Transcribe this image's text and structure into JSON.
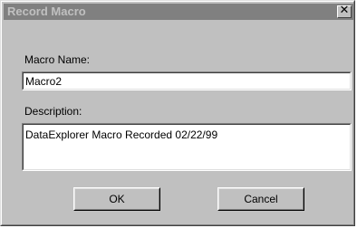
{
  "dialog": {
    "title": "Record Macro",
    "close_glyph": "✕",
    "macro_name_label": "Macro Name:",
    "macro_name_value": "Macro2",
    "description_label": "Description:",
    "description_value": "DataExplorer Macro Recorded 02/22/99",
    "ok_label": "OK",
    "cancel_label": "Cancel"
  },
  "colors": {
    "face": "#c0c0c0",
    "title_bar_inactive": "#808080",
    "title_text_inactive": "#c0c0c0",
    "field_bg": "#ffffff"
  },
  "icons": {
    "close": "close-icon"
  }
}
